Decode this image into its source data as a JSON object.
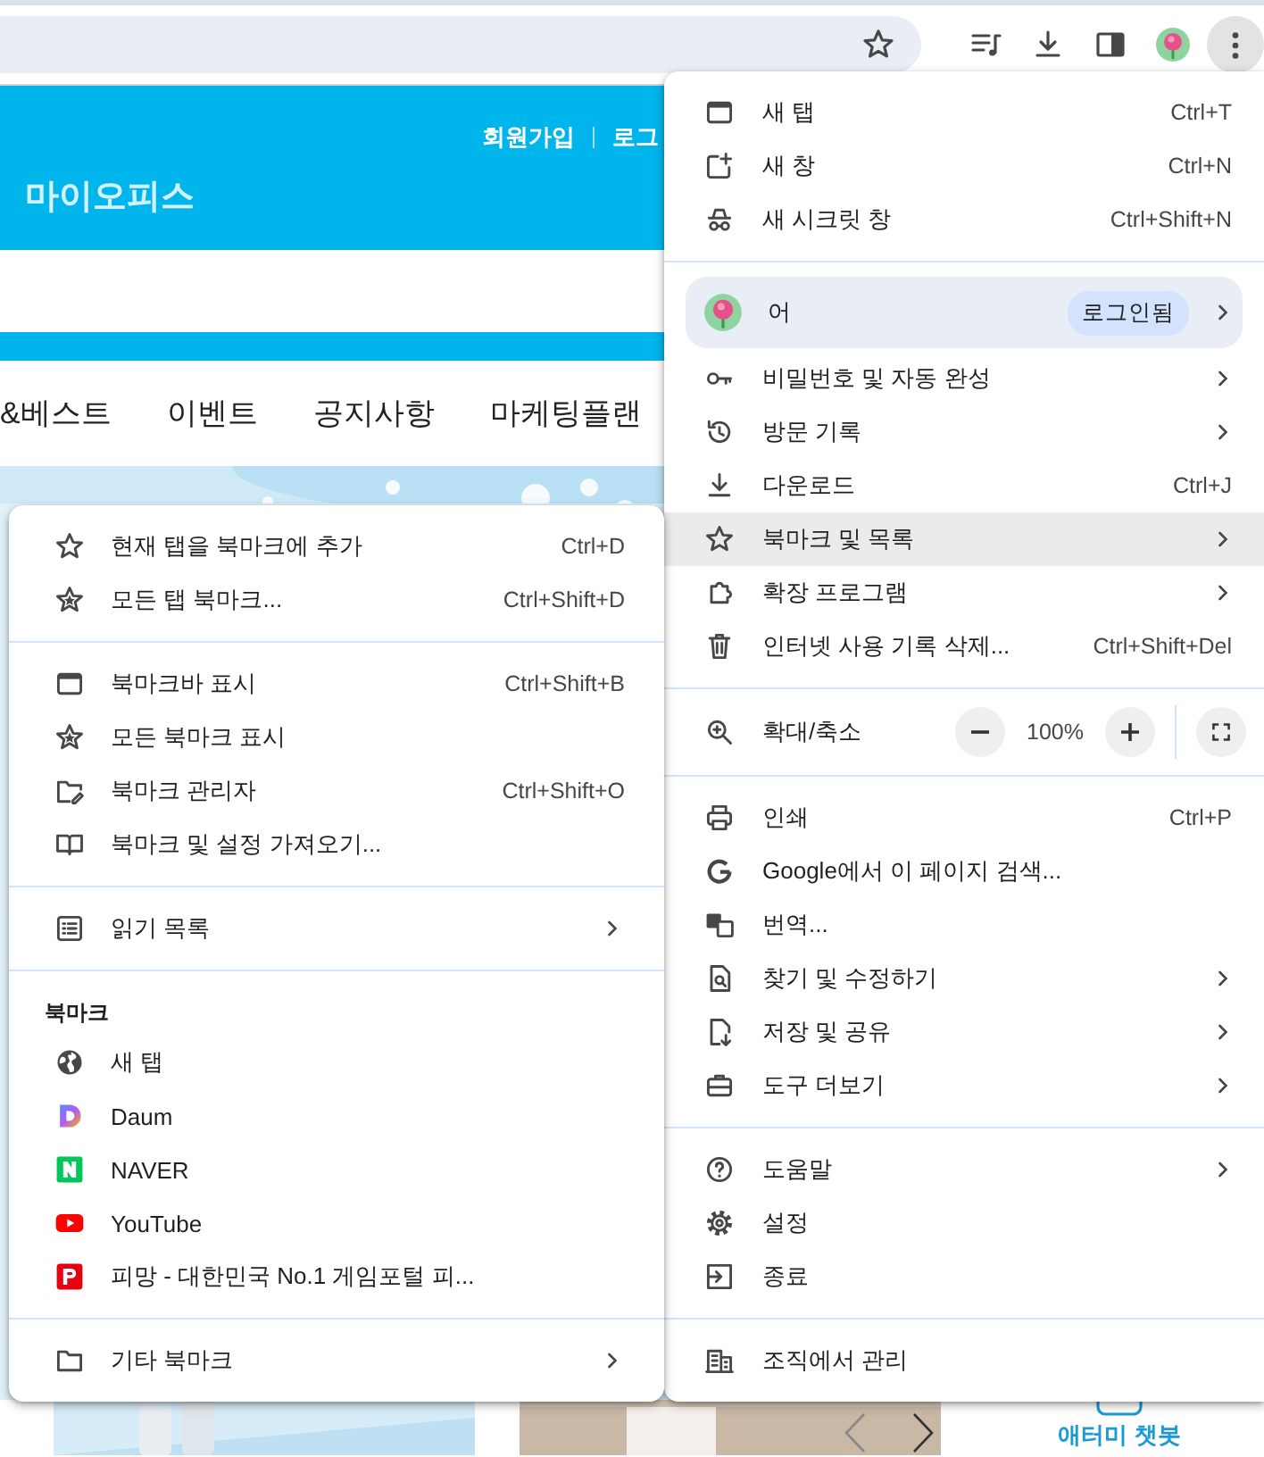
{
  "toolbar": {
    "menu_button_pressed": true
  },
  "site": {
    "logo": "마이오피스",
    "account_links": [
      "회원가입",
      "로그"
    ],
    "nav": [
      "&베스트",
      "이벤트",
      "공지사항",
      "마케팅플랜"
    ],
    "chatbot_label": "애터미 챗봇"
  },
  "app_menu": {
    "sections": [
      [
        {
          "kind": "item",
          "label": "새 탭",
          "shortcut": "Ctrl+T",
          "submenu": false,
          "highlighted": false
        },
        {
          "kind": "item",
          "label": "새 창",
          "shortcut": "Ctrl+N",
          "submenu": false,
          "highlighted": false
        },
        {
          "kind": "item",
          "label": "새 시크릿 창",
          "shortcut": "Ctrl+Shift+N",
          "submenu": false,
          "highlighted": false
        }
      ],
      [
        {
          "kind": "profile",
          "name": "어",
          "badge": "로그인됨",
          "submenu": true,
          "highlighted": false
        },
        {
          "kind": "item",
          "label": "비밀번호 및 자동 완성",
          "submenu": true,
          "highlighted": false
        },
        {
          "kind": "item",
          "label": "방문 기록",
          "submenu": true,
          "highlighted": false
        },
        {
          "kind": "item",
          "label": "다운로드",
          "shortcut": "Ctrl+J",
          "submenu": false,
          "highlighted": false
        },
        {
          "kind": "item",
          "label": "북마크 및 목록",
          "submenu": true,
          "highlighted": true
        },
        {
          "kind": "item",
          "label": "확장 프로그램",
          "submenu": true,
          "highlighted": false
        },
        {
          "kind": "item",
          "label": "인터넷 사용 기록 삭제...",
          "shortcut": "Ctrl+Shift+Del",
          "submenu": false,
          "highlighted": false
        }
      ],
      [
        {
          "kind": "zoom",
          "label": "확대/축소",
          "value": "100%"
        }
      ],
      [
        {
          "kind": "item",
          "label": "인쇄",
          "shortcut": "Ctrl+P",
          "submenu": false,
          "highlighted": false
        },
        {
          "kind": "item",
          "label": "Google에서 이 페이지 검색...",
          "submenu": false,
          "highlighted": false
        },
        {
          "kind": "item",
          "label": "번역...",
          "submenu": false,
          "highlighted": false
        },
        {
          "kind": "item",
          "label": "찾기 및 수정하기",
          "submenu": true,
          "highlighted": false
        },
        {
          "kind": "item",
          "label": "저장 및 공유",
          "submenu": true,
          "highlighted": false
        },
        {
          "kind": "item",
          "label": "도구 더보기",
          "submenu": true,
          "highlighted": false
        }
      ],
      [
        {
          "kind": "item",
          "label": "도움말",
          "submenu": true,
          "highlighted": false
        },
        {
          "kind": "item",
          "label": "설정",
          "submenu": false,
          "highlighted": false
        },
        {
          "kind": "item",
          "label": "종료",
          "submenu": false,
          "highlighted": false
        }
      ],
      [
        {
          "kind": "item",
          "label": "조직에서 관리",
          "submenu": false,
          "highlighted": false
        }
      ]
    ]
  },
  "bookmarks_menu": {
    "sections": [
      [
        {
          "kind": "item",
          "label": "현재 탭을 북마크에 추가",
          "shortcut": "Ctrl+D",
          "submenu": false,
          "highlighted": false
        },
        {
          "kind": "item",
          "label": "모든 탭 북마크...",
          "shortcut": "Ctrl+Shift+D",
          "submenu": false,
          "highlighted": false
        }
      ],
      [
        {
          "kind": "item",
          "label": "북마크바 표시",
          "shortcut": "Ctrl+Shift+B",
          "submenu": false,
          "highlighted": false
        },
        {
          "kind": "item",
          "label": "모든 북마크 표시",
          "submenu": false,
          "highlighted": false
        },
        {
          "kind": "item",
          "label": "북마크 관리자",
          "shortcut": "Ctrl+Shift+O",
          "submenu": false,
          "highlighted": false
        },
        {
          "kind": "item",
          "label": "북마크 및 설정 가져오기...",
          "submenu": false,
          "highlighted": false
        }
      ],
      [
        {
          "kind": "item",
          "label": "읽기 목록",
          "submenu": true,
          "highlighted": false
        }
      ],
      [
        {
          "kind": "header",
          "label": "북마크"
        },
        {
          "kind": "item",
          "label": "새 탭",
          "submenu": false,
          "highlighted": false
        },
        {
          "kind": "item",
          "label": "Daum",
          "submenu": false,
          "highlighted": false
        },
        {
          "kind": "item",
          "label": "NAVER",
          "submenu": false,
          "highlighted": false
        },
        {
          "kind": "item",
          "label": "YouTube",
          "submenu": false,
          "highlighted": false
        },
        {
          "kind": "item",
          "label": "피망 - 대한민국 No.1 게임포털 피...",
          "submenu": false,
          "highlighted": false
        }
      ],
      [
        {
          "kind": "item",
          "label": "기타 북마크",
          "submenu": true,
          "highlighted": false
        }
      ]
    ]
  }
}
